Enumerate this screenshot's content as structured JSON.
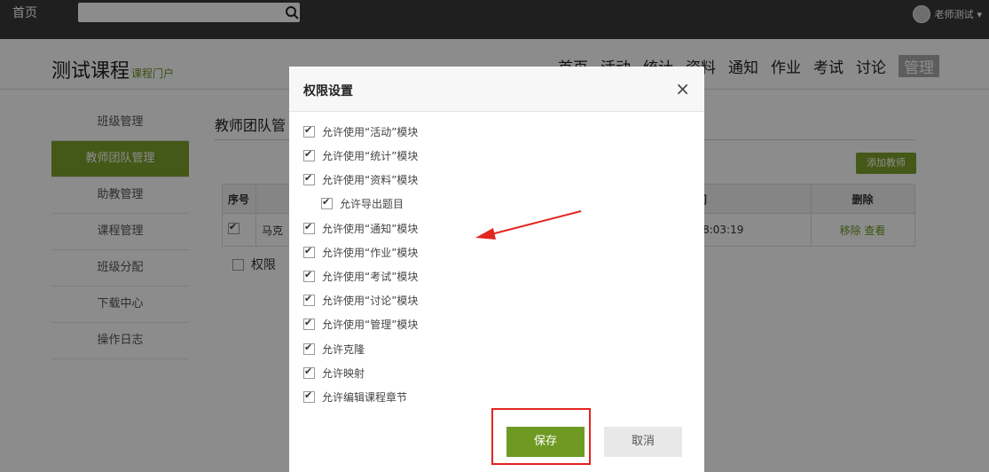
{
  "topbar": {
    "home": "首页",
    "search_placeholder": "",
    "user_name": "老师测试",
    "user_caret": "▾"
  },
  "header": {
    "course_title": "测试课程",
    "course_subtitle": "课程门户",
    "nav": [
      "首页",
      "活动",
      "统计",
      "资料",
      "通知",
      "作业",
      "考试",
      "讨论",
      "管理"
    ]
  },
  "sidebar": {
    "items": [
      {
        "label": "班级管理",
        "active": false
      },
      {
        "label": "教师团队管理",
        "active": true
      },
      {
        "label": "助教管理",
        "active": false
      },
      {
        "label": "课程管理",
        "active": false
      },
      {
        "label": "班级分配",
        "active": false
      },
      {
        "label": "下载中心",
        "active": false
      },
      {
        "label": "操作日志",
        "active": false
      }
    ]
  },
  "main": {
    "title": "教师团队管",
    "add_teacher": "添加教师",
    "table": {
      "headers": [
        "序号",
        "",
        "时间",
        "删除"
      ],
      "rows": [
        {
          "checked": true,
          "name": "马克",
          "time": "1 18:03:19",
          "remove": "移除",
          "view": "查看"
        }
      ]
    },
    "permissions_label": "权限"
  },
  "modal": {
    "title": "权限设置",
    "close": "×",
    "options": [
      {
        "label": "允许使用“活动”模块",
        "checked": true,
        "sub": false
      },
      {
        "label": "允许使用“统计”模块",
        "checked": true,
        "sub": false
      },
      {
        "label": "允许使用“资料”模块",
        "checked": true,
        "sub": false
      },
      {
        "label": "允许导出题目",
        "checked": true,
        "sub": true
      },
      {
        "label": "允许使用“通知”模块",
        "checked": true,
        "sub": false
      },
      {
        "label": "允许使用“作业”模块",
        "checked": true,
        "sub": false
      },
      {
        "label": "允许使用“考试”模块",
        "checked": true,
        "sub": false
      },
      {
        "label": "允许使用“讨论”模块",
        "checked": true,
        "sub": false
      },
      {
        "label": "允许使用“管理”模块",
        "checked": true,
        "sub": false
      },
      {
        "label": "允许克隆",
        "checked": true,
        "sub": false
      },
      {
        "label": "允许映射",
        "checked": true,
        "sub": false
      },
      {
        "label": "允许编辑课程章节",
        "checked": true,
        "sub": false
      }
    ],
    "save": "保存",
    "cancel": "取消"
  },
  "colors": {
    "accent": "#7da12a",
    "annotation": "#e3241f"
  }
}
